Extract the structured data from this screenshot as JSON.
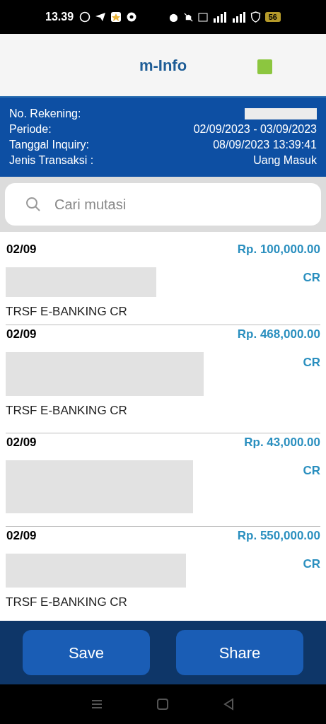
{
  "status_bar": {
    "time": "13.39",
    "battery": "56"
  },
  "header": {
    "title": "m-Info"
  },
  "account_info": [
    {
      "label": "No. Rekening:",
      "value_redacted": true
    },
    {
      "label": "Periode:",
      "value": "02/09/2023 - 03/09/2023"
    },
    {
      "label": "Tanggal Inquiry:",
      "value": "08/09/2023 13:39:41"
    },
    {
      "label": "Jenis Transaksi :",
      "value": "Uang Masuk"
    }
  ],
  "search": {
    "placeholder": "Cari mutasi"
  },
  "transactions": [
    {
      "date": "02/09",
      "amount": "Rp. 100,000.00",
      "type": "CR",
      "description": "TRSF E-BANKING CR"
    },
    {
      "date": "02/09",
      "amount": "Rp. 468,000.00",
      "type": "CR",
      "description": "TRSF E-BANKING CR"
    },
    {
      "date": "02/09",
      "amount": "Rp. 43,000.00",
      "type": "CR"
    },
    {
      "date": "02/09",
      "amount": "Rp. 550,000.00",
      "type": "CR",
      "description": "TRSF E-BANKING CR"
    }
  ],
  "buttons": [
    "Save",
    "Share"
  ]
}
